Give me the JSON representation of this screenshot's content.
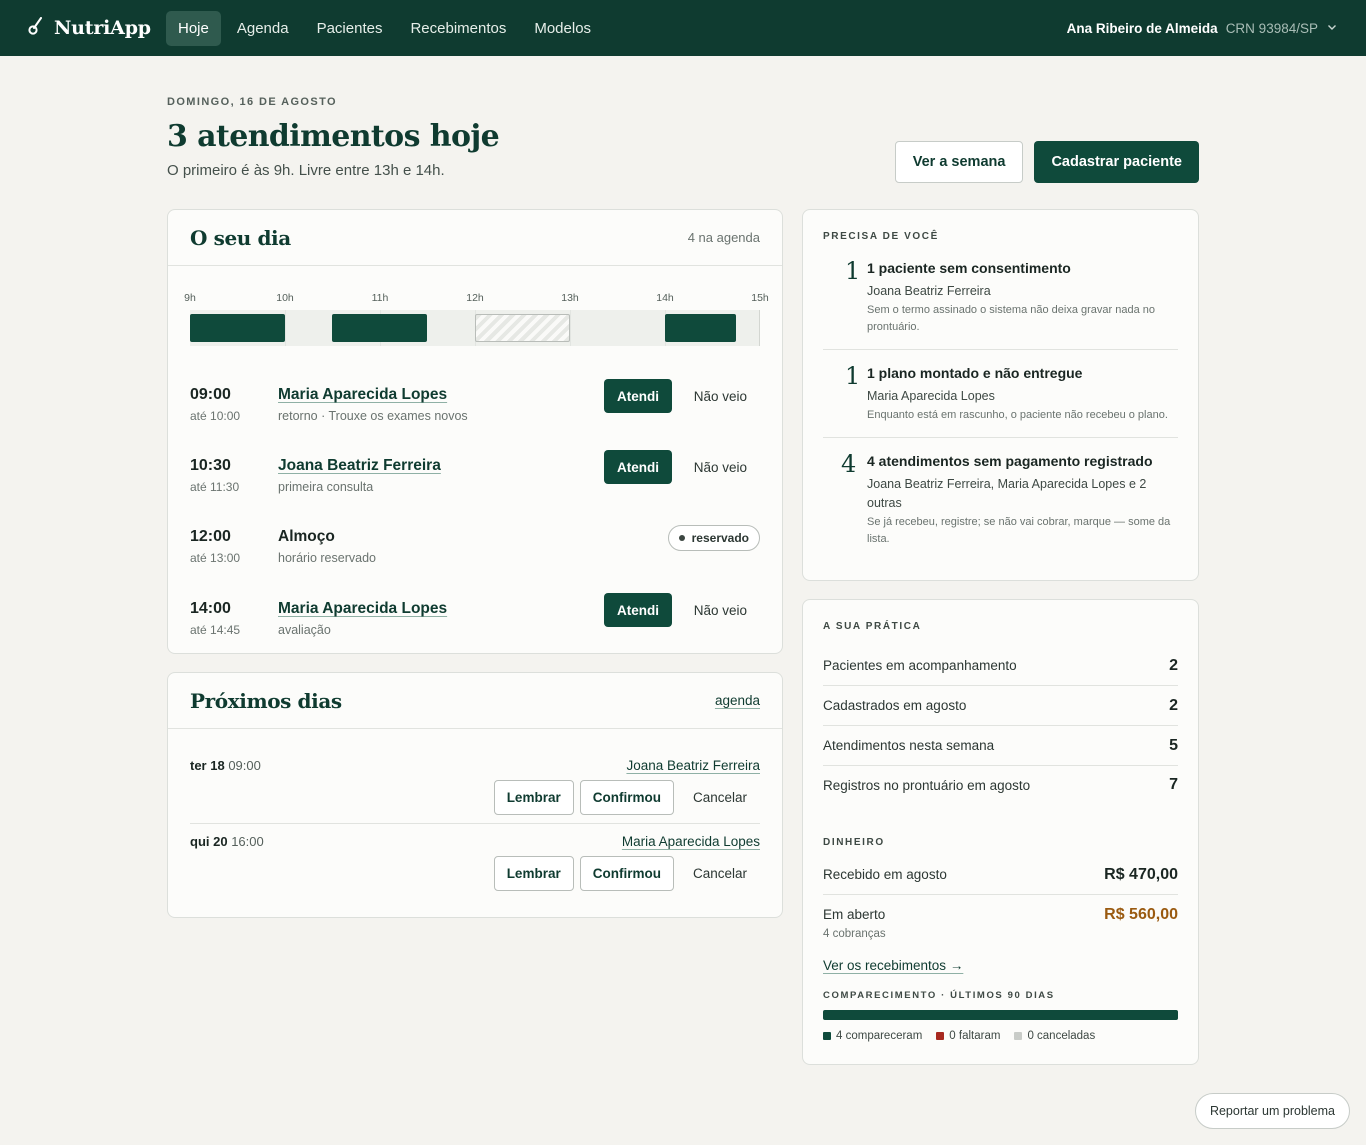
{
  "app": {
    "brand": "NutriApp"
  },
  "nav": [
    {
      "label": "Hoje",
      "active": true
    },
    {
      "label": "Agenda",
      "active": false
    },
    {
      "label": "Pacientes",
      "active": false
    },
    {
      "label": "Recebimentos",
      "active": false
    },
    {
      "label": "Modelos",
      "active": false
    }
  ],
  "user": {
    "name": "Ana Ribeiro de Almeida",
    "crn": "CRN 93984/SP"
  },
  "header": {
    "date": "DOMINGO, 16 DE AGOSTO",
    "title": "3 atendimentos hoje",
    "subtitle": "O primeiro é às 9h. Livre entre 13h e 14h.",
    "week_button": "Ver a semana",
    "register_button": "Cadastrar paciente"
  },
  "day": {
    "title": "O seu dia",
    "meta": "4 na agenda",
    "hours": [
      "9h",
      "10h",
      "11h",
      "12h",
      "13h",
      "14h",
      "15h"
    ],
    "appointments": [
      {
        "time": "09:00",
        "until": "até 10:00",
        "name": "Maria Aparecida Lopes",
        "desc": "retorno · Trouxe os exames novos",
        "primary": "Atendi",
        "secondary": "Não veio",
        "is_link": true
      },
      {
        "time": "10:30",
        "until": "até 11:30",
        "name": "Joana Beatriz Ferreira",
        "desc": "primeira consulta",
        "primary": "Atendi",
        "secondary": "Não veio",
        "is_link": true
      },
      {
        "time": "12:00",
        "until": "até 13:00",
        "name": "Almoço",
        "desc": "horário reservado",
        "badge": "reservado",
        "is_link": false
      },
      {
        "time": "14:00",
        "until": "até 14:45",
        "name": "Maria Aparecida Lopes",
        "desc": "avaliação",
        "primary": "Atendi",
        "secondary": "Não veio",
        "is_link": true
      }
    ]
  },
  "upcoming": {
    "title": "Próximos dias",
    "link": "agenda",
    "items": [
      {
        "day": "ter 18",
        "time": "09:00",
        "name": "Joana Beatriz Ferreira",
        "remind": "Lembrar",
        "confirm": "Confirmou",
        "cancel": "Cancelar"
      },
      {
        "day": "qui 20",
        "time": "16:00",
        "name": "Maria Aparecida Lopes",
        "remind": "Lembrar",
        "confirm": "Confirmou",
        "cancel": "Cancelar"
      }
    ]
  },
  "needs": {
    "label": "PRECISA DE VOCÊ",
    "items": [
      {
        "count": "1",
        "title": "1 paciente sem consentimento",
        "sub": "Joana Beatriz Ferreira",
        "note": "Sem o termo assinado o sistema não deixa gravar nada no prontuário."
      },
      {
        "count": "1",
        "title": "1 plano montado e não entregue",
        "sub": "Maria Aparecida Lopes",
        "note": "Enquanto está em rascunho, o paciente não recebeu o plano."
      },
      {
        "count": "4",
        "title": "4 atendimentos sem pagamento registrado",
        "sub": "Joana Beatriz Ferreira, Maria Aparecida Lopes e 2 outras",
        "note": "Se já recebeu, registre; se não vai cobrar, marque — some da lista."
      }
    ]
  },
  "practice": {
    "label": "A SUA PRÁTICA",
    "stats": [
      {
        "label": "Pacientes em acompanhamento",
        "value": "2"
      },
      {
        "label": "Cadastrados em agosto",
        "value": "2"
      },
      {
        "label": "Atendimentos nesta semana",
        "value": "5"
      },
      {
        "label": "Registros no prontuário em agosto",
        "value": "7"
      }
    ],
    "money_label": "DINHEIRO",
    "received_label": "Recebido em agosto",
    "received_value": "R$ 470,00",
    "open_label": "Em aberto",
    "open_sub": "4 cobranças",
    "open_value": "R$ 560,00",
    "receipts_link": "Ver os recebimentos →",
    "attendance_label": "COMPARECIMENTO · ÚLTIMOS 90 DIAS",
    "attendance_fraction": 1.0,
    "legend": [
      {
        "label": "4 compareceram",
        "color": "#0f4a3b"
      },
      {
        "label": "0 faltaram",
        "color": "#a8291f"
      },
      {
        "label": "0 canceladas",
        "color": "#c9ccc8"
      }
    ]
  },
  "report_button": "Reportar um problema"
}
